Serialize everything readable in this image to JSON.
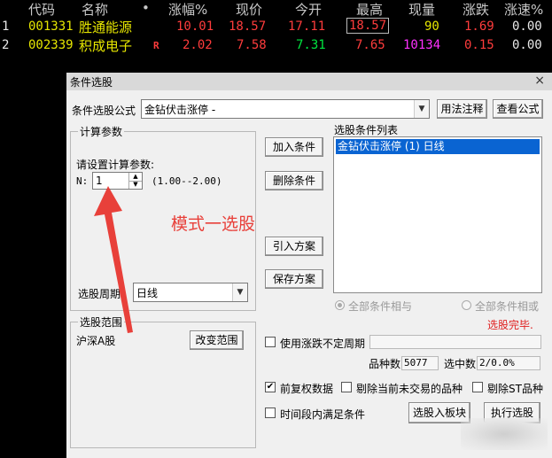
{
  "table": {
    "headers": [
      "代码",
      "名称",
      "•",
      "涨幅%",
      "现价",
      "今开",
      "最高",
      "现量",
      "涨跌",
      "涨速%"
    ],
    "rows": [
      {
        "index": "1",
        "code": "001331",
        "name": "胜通能源",
        "flag": "",
        "change_pct": "10.01",
        "price": "18.57",
        "open": "17.11",
        "high": "18.57",
        "volume": "90",
        "change": "1.69",
        "speed": "0.00"
      },
      {
        "index": "2",
        "code": "002339",
        "name": "积成电子",
        "flag": "R",
        "change_pct": "2.02",
        "price": "7.58",
        "open": "7.31",
        "high": "7.65",
        "volume": "10134",
        "change": "0.15",
        "speed": "0.00"
      }
    ]
  },
  "dialog": {
    "title": "条件选股",
    "close_icon": "×",
    "formula_label": "条件选股公式",
    "formula_value": "金钻伏击涨停 -",
    "usage_button": "用法注释",
    "view_formula_button": "查看公式",
    "calc_params": {
      "legend": "计算参数",
      "prompt": "请设置计算参数:",
      "n_label": "N:",
      "n_value": "1",
      "range": "(1.00--2.00)"
    },
    "period_label": "选股周期:",
    "period_value": "日线",
    "add_button": "加入条件",
    "delete_button": "删除条件",
    "import_button": "引入方案",
    "save_button": "保存方案",
    "conditions_title": "选股条件列表",
    "conditions": [
      "金钻伏击涨停 (1) 日线"
    ],
    "radio_and": "全部条件相与",
    "radio_or": "全部条件相或",
    "status": "选股完毕.",
    "range_group": {
      "legend": "选股范围",
      "value": "沪深A股",
      "change_button": "改变范围"
    },
    "use_period_label": "使用涨跌不定周期",
    "count_label": "品种数",
    "count_value": "5077",
    "selected_label": "选中数",
    "selected_value": "2/0.0%",
    "pre_adjust_label": "前复权数据",
    "exclude_untraded_label": "剔除当前未交易的品种",
    "exclude_st_label": "剔除ST品种",
    "time_range_label": "时间段内满足条件",
    "to_block_button": "选股入板块",
    "execute_button": "执行选股"
  },
  "annotation": {
    "text": "模式一选股",
    "color": "#e8403a"
  }
}
